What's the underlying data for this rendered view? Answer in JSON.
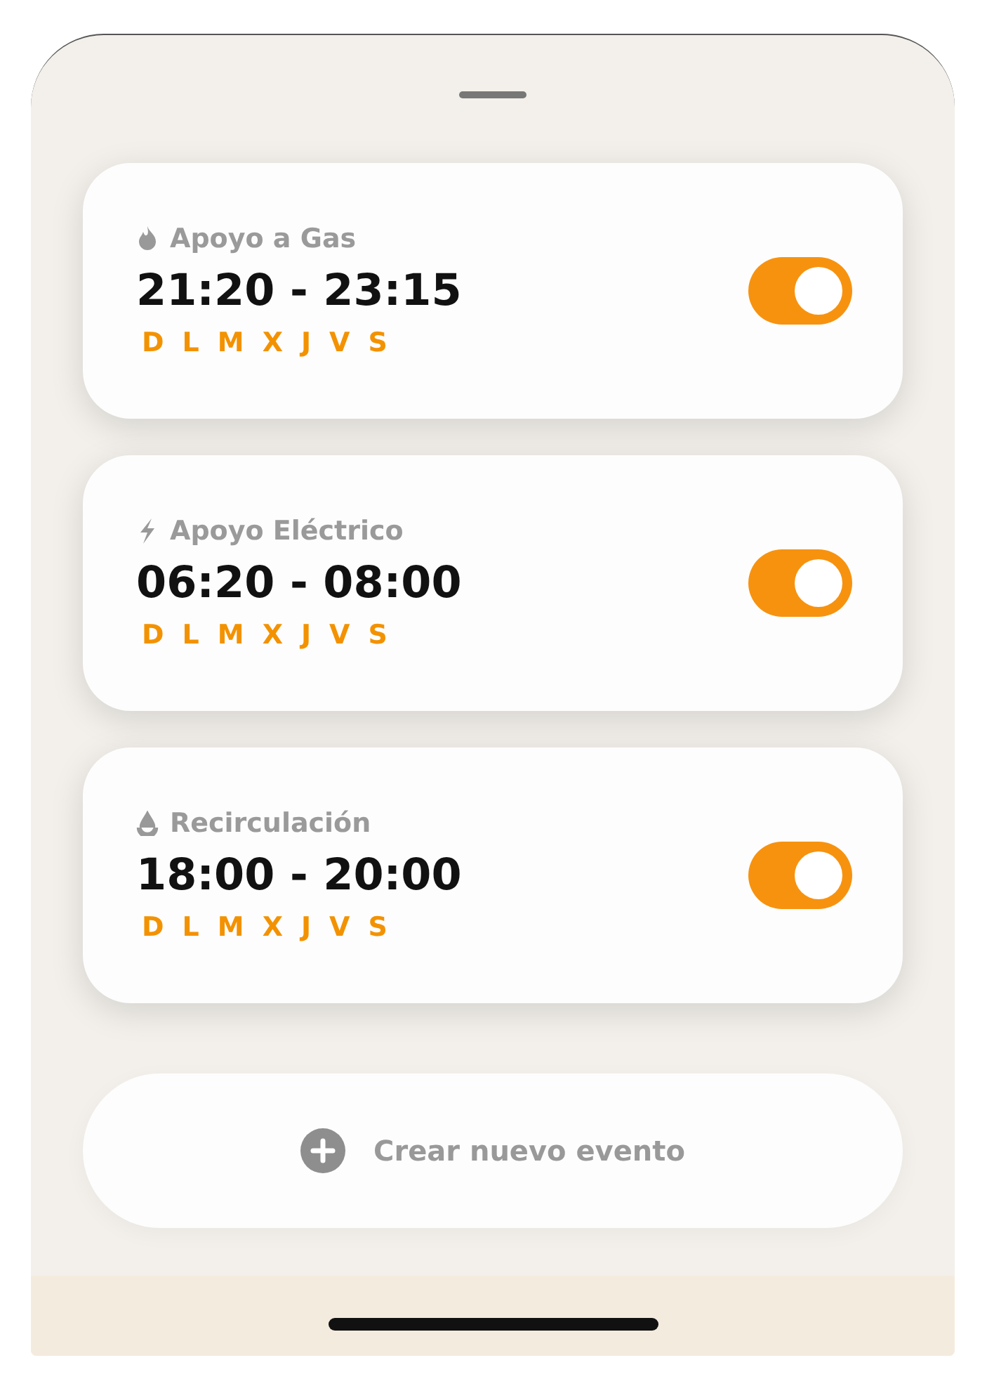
{
  "events": [
    {
      "kind": "gas",
      "title": "Apoyo a Gas",
      "time": "21:20 - 23:15",
      "days": [
        "D",
        "L",
        "M",
        "X",
        "J",
        "V",
        "S"
      ],
      "on": true
    },
    {
      "kind": "electric",
      "title": "Apoyo Eléctrico",
      "time": "06:20 - 08:00",
      "days": [
        "D",
        "L",
        "M",
        "X",
        "J",
        "V",
        "S"
      ],
      "on": true
    },
    {
      "kind": "recirculation",
      "title": "Recirculación",
      "time": "18:00 - 20:00",
      "days": [
        "D",
        "L",
        "M",
        "X",
        "J",
        "V",
        "S"
      ],
      "on": true
    }
  ],
  "create_button": {
    "label": "Crear nuevo evento"
  }
}
